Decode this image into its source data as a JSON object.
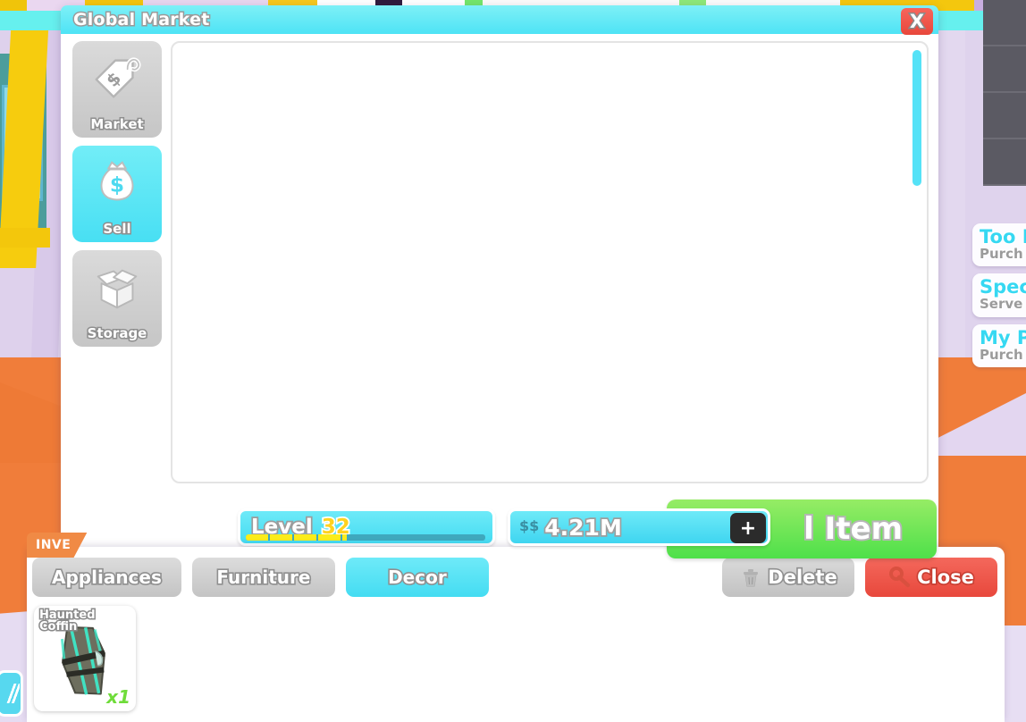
{
  "dialog": {
    "title": "Global Market",
    "close_label": "X",
    "nav": [
      {
        "label": "Market",
        "icon": "price-tag-icon",
        "active": false
      },
      {
        "label": "Sell",
        "icon": "money-bag-icon",
        "active": true
      },
      {
        "label": "Storage",
        "icon": "open-box-icon",
        "active": false
      }
    ],
    "status": {
      "level_word": "Level",
      "level_value": "32",
      "level_progress_percent": 42,
      "level_segments": 10,
      "money_symbol": "$$",
      "money_value": "4.21M",
      "money_add_label": "+",
      "sell_item_label": "Sell Item",
      "sell_item_visible_label": "l Item"
    }
  },
  "inventory": {
    "tag_label": "INVENTORY",
    "tag_visible_label": "INVE",
    "tabs": [
      {
        "label": "Appliances",
        "active": false
      },
      {
        "label": "Furniture",
        "active": false
      },
      {
        "label": "Decor",
        "active": true
      }
    ],
    "actions": [
      {
        "label": "Delete",
        "icon": "trash-icon",
        "style": "delete"
      },
      {
        "label": "Close",
        "icon": "key-icon",
        "style": "close"
      }
    ],
    "items": [
      {
        "name": "Haunted Coffin",
        "count": "x1",
        "art": "coffin-icon"
      }
    ]
  },
  "notifications": [
    {
      "title": "Too M",
      "subtitle": "Purch"
    },
    {
      "title": "Spec",
      "subtitle": "Serve"
    },
    {
      "title": "My P",
      "subtitle": "Purch"
    }
  ],
  "colors": {
    "accent_cyan": "#4ee3f5",
    "accent_green": "#4ee04a",
    "accent_red": "#e8483c",
    "accent_yellow": "#ffd21f",
    "floor_orange": "#f07d3a",
    "wall_lavender": "#e0d5ec",
    "inactive_gray": "#c6c6c6"
  }
}
